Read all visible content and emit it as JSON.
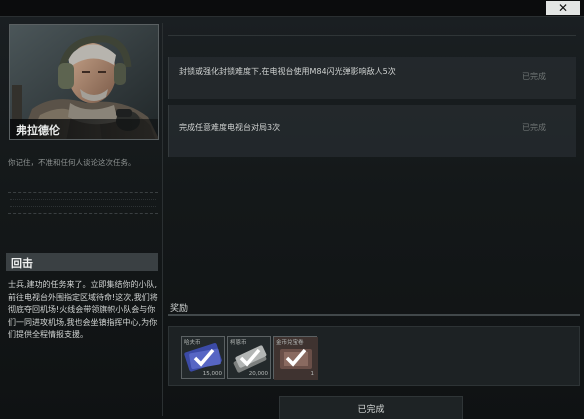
{
  "window": {
    "close_icon": "close-icon",
    "close_label": "✕"
  },
  "trader": {
    "name": "弗拉德伦",
    "note": "你记住，不准和任何人谈论这次任务。"
  },
  "briefing": {
    "heading": "回击",
    "text": "士兵,建功的任务来了。立即集结你的小队,前往电视台外围指定区域待命!这次,我们将彻底夺回机场!火线会带领旗帜小队会与你们一同进攻机场,我也会坐镇指挥中心,为你们提供全程情报支援。"
  },
  "objectives": [
    {
      "text": "封锁或强化封锁难度下,在电视台使用M84闪光弹影响敌人5次",
      "status": "已完成"
    },
    {
      "text": "完成任意难度电视台对局3次",
      "status": "已完成"
    }
  ],
  "rewards": {
    "label": "奖励",
    "items": [
      {
        "name": "哈夫币",
        "count": "15,000",
        "icon": "banknote-icon",
        "color": "#3b4aa6"
      },
      {
        "name": "柯恩币",
        "count": "20,000",
        "icon": "cash-stack-icon",
        "color": "#9a9d9c"
      },
      {
        "name": "金币兑宝卷",
        "count": "1",
        "icon": "ticket-icon",
        "color": "#6a4f48"
      }
    ]
  },
  "complete_button": "已完成"
}
